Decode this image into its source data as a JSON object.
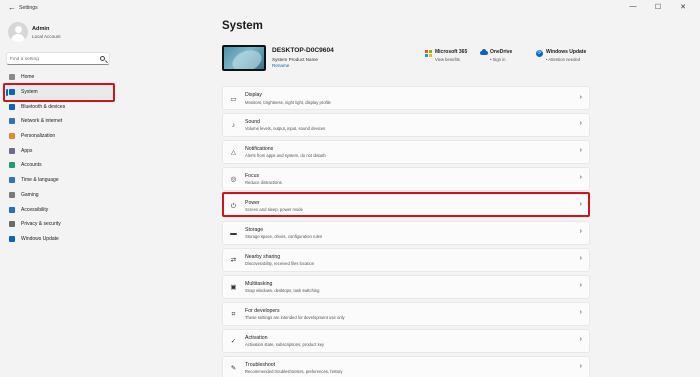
{
  "window": {
    "title": "Settings",
    "back_glyph": "←",
    "minimize_glyph": "—",
    "maximize_glyph": "☐",
    "close_glyph": "✕"
  },
  "user": {
    "name": "Admin",
    "account": "Local Account"
  },
  "search": {
    "placeholder": "Find a setting"
  },
  "sidebar": {
    "items": [
      {
        "label": "Home",
        "icon": "home-icon",
        "color": "#8a8a8a"
      },
      {
        "label": "System",
        "icon": "system-icon",
        "color": "#0a64c8"
      },
      {
        "label": "Bluetooth & devices",
        "icon": "bluetooth-icon",
        "color": "#0a64c8"
      },
      {
        "label": "Network & internet",
        "icon": "network-icon",
        "color": "#2d74c4"
      },
      {
        "label": "Personalization",
        "icon": "brush-icon",
        "color": "#e08a2c"
      },
      {
        "label": "Apps",
        "icon": "apps-icon",
        "color": "#6b6b8f"
      },
      {
        "label": "Accounts",
        "icon": "accounts-icon",
        "color": "#1f9d6e"
      },
      {
        "label": "Time & language",
        "icon": "time-icon",
        "color": "#2d74c4"
      },
      {
        "label": "Gaming",
        "icon": "gaming-icon",
        "color": "#7a7a7a"
      },
      {
        "label": "Accessibility",
        "icon": "accessibility-icon",
        "color": "#1a73c9"
      },
      {
        "label": "Privacy & security",
        "icon": "shield-icon",
        "color": "#6b6b6b"
      },
      {
        "label": "Windows Update",
        "icon": "update-icon",
        "color": "#0a64c8"
      }
    ],
    "selected_index": 1
  },
  "main": {
    "title": "System",
    "device": {
      "name": "DESKTOP-D0C9604",
      "model": "System Product Name",
      "rename": "Rename"
    },
    "services": [
      {
        "title": "Microsoft 365",
        "subtitle": "View benefits",
        "icon": "microsoft-logo-icon"
      },
      {
        "title": "OneDrive",
        "subtitle": "• Sign in",
        "icon": "cloud-icon"
      },
      {
        "title": "Windows Update",
        "subtitle": "• Attention needed",
        "icon": "update-icon"
      }
    ],
    "chevron": "›",
    "cards": [
      {
        "title": "Display",
        "subtitle": "Monitors, brightness, night light, display profile",
        "icon": "display-icon",
        "glyph": "▭"
      },
      {
        "title": "Sound",
        "subtitle": "Volume levels, output, input, sound devices",
        "icon": "speaker-icon",
        "glyph": "♪"
      },
      {
        "title": "Notifications",
        "subtitle": "Alerts from apps and system, do not disturb",
        "icon": "bell-icon",
        "glyph": "△"
      },
      {
        "title": "Focus",
        "subtitle": "Reduce distractions",
        "icon": "focus-icon",
        "glyph": "◎"
      },
      {
        "title": "Power",
        "subtitle": "Screen and sleep, power mode",
        "icon": "power-icon",
        "glyph": "⏻"
      },
      {
        "title": "Storage",
        "subtitle": "Storage space, drives, configuration rules",
        "icon": "storage-icon",
        "glyph": "▬"
      },
      {
        "title": "Nearby sharing",
        "subtitle": "Discoverability, received files location",
        "icon": "share-icon",
        "glyph": "⇄"
      },
      {
        "title": "Multitasking",
        "subtitle": "Snap windows, desktops, task switching",
        "icon": "multitasking-icon",
        "glyph": "▣"
      },
      {
        "title": "For developers",
        "subtitle": "These settings are intended for development use only",
        "icon": "developer-icon",
        "glyph": "⌗"
      },
      {
        "title": "Activation",
        "subtitle": "Activation state, subscriptions, product key",
        "icon": "activation-icon",
        "glyph": "✓"
      },
      {
        "title": "Troubleshoot",
        "subtitle": "Recommended troubleshooters, preferences, history",
        "icon": "wrench-icon",
        "glyph": "✎"
      }
    ]
  }
}
